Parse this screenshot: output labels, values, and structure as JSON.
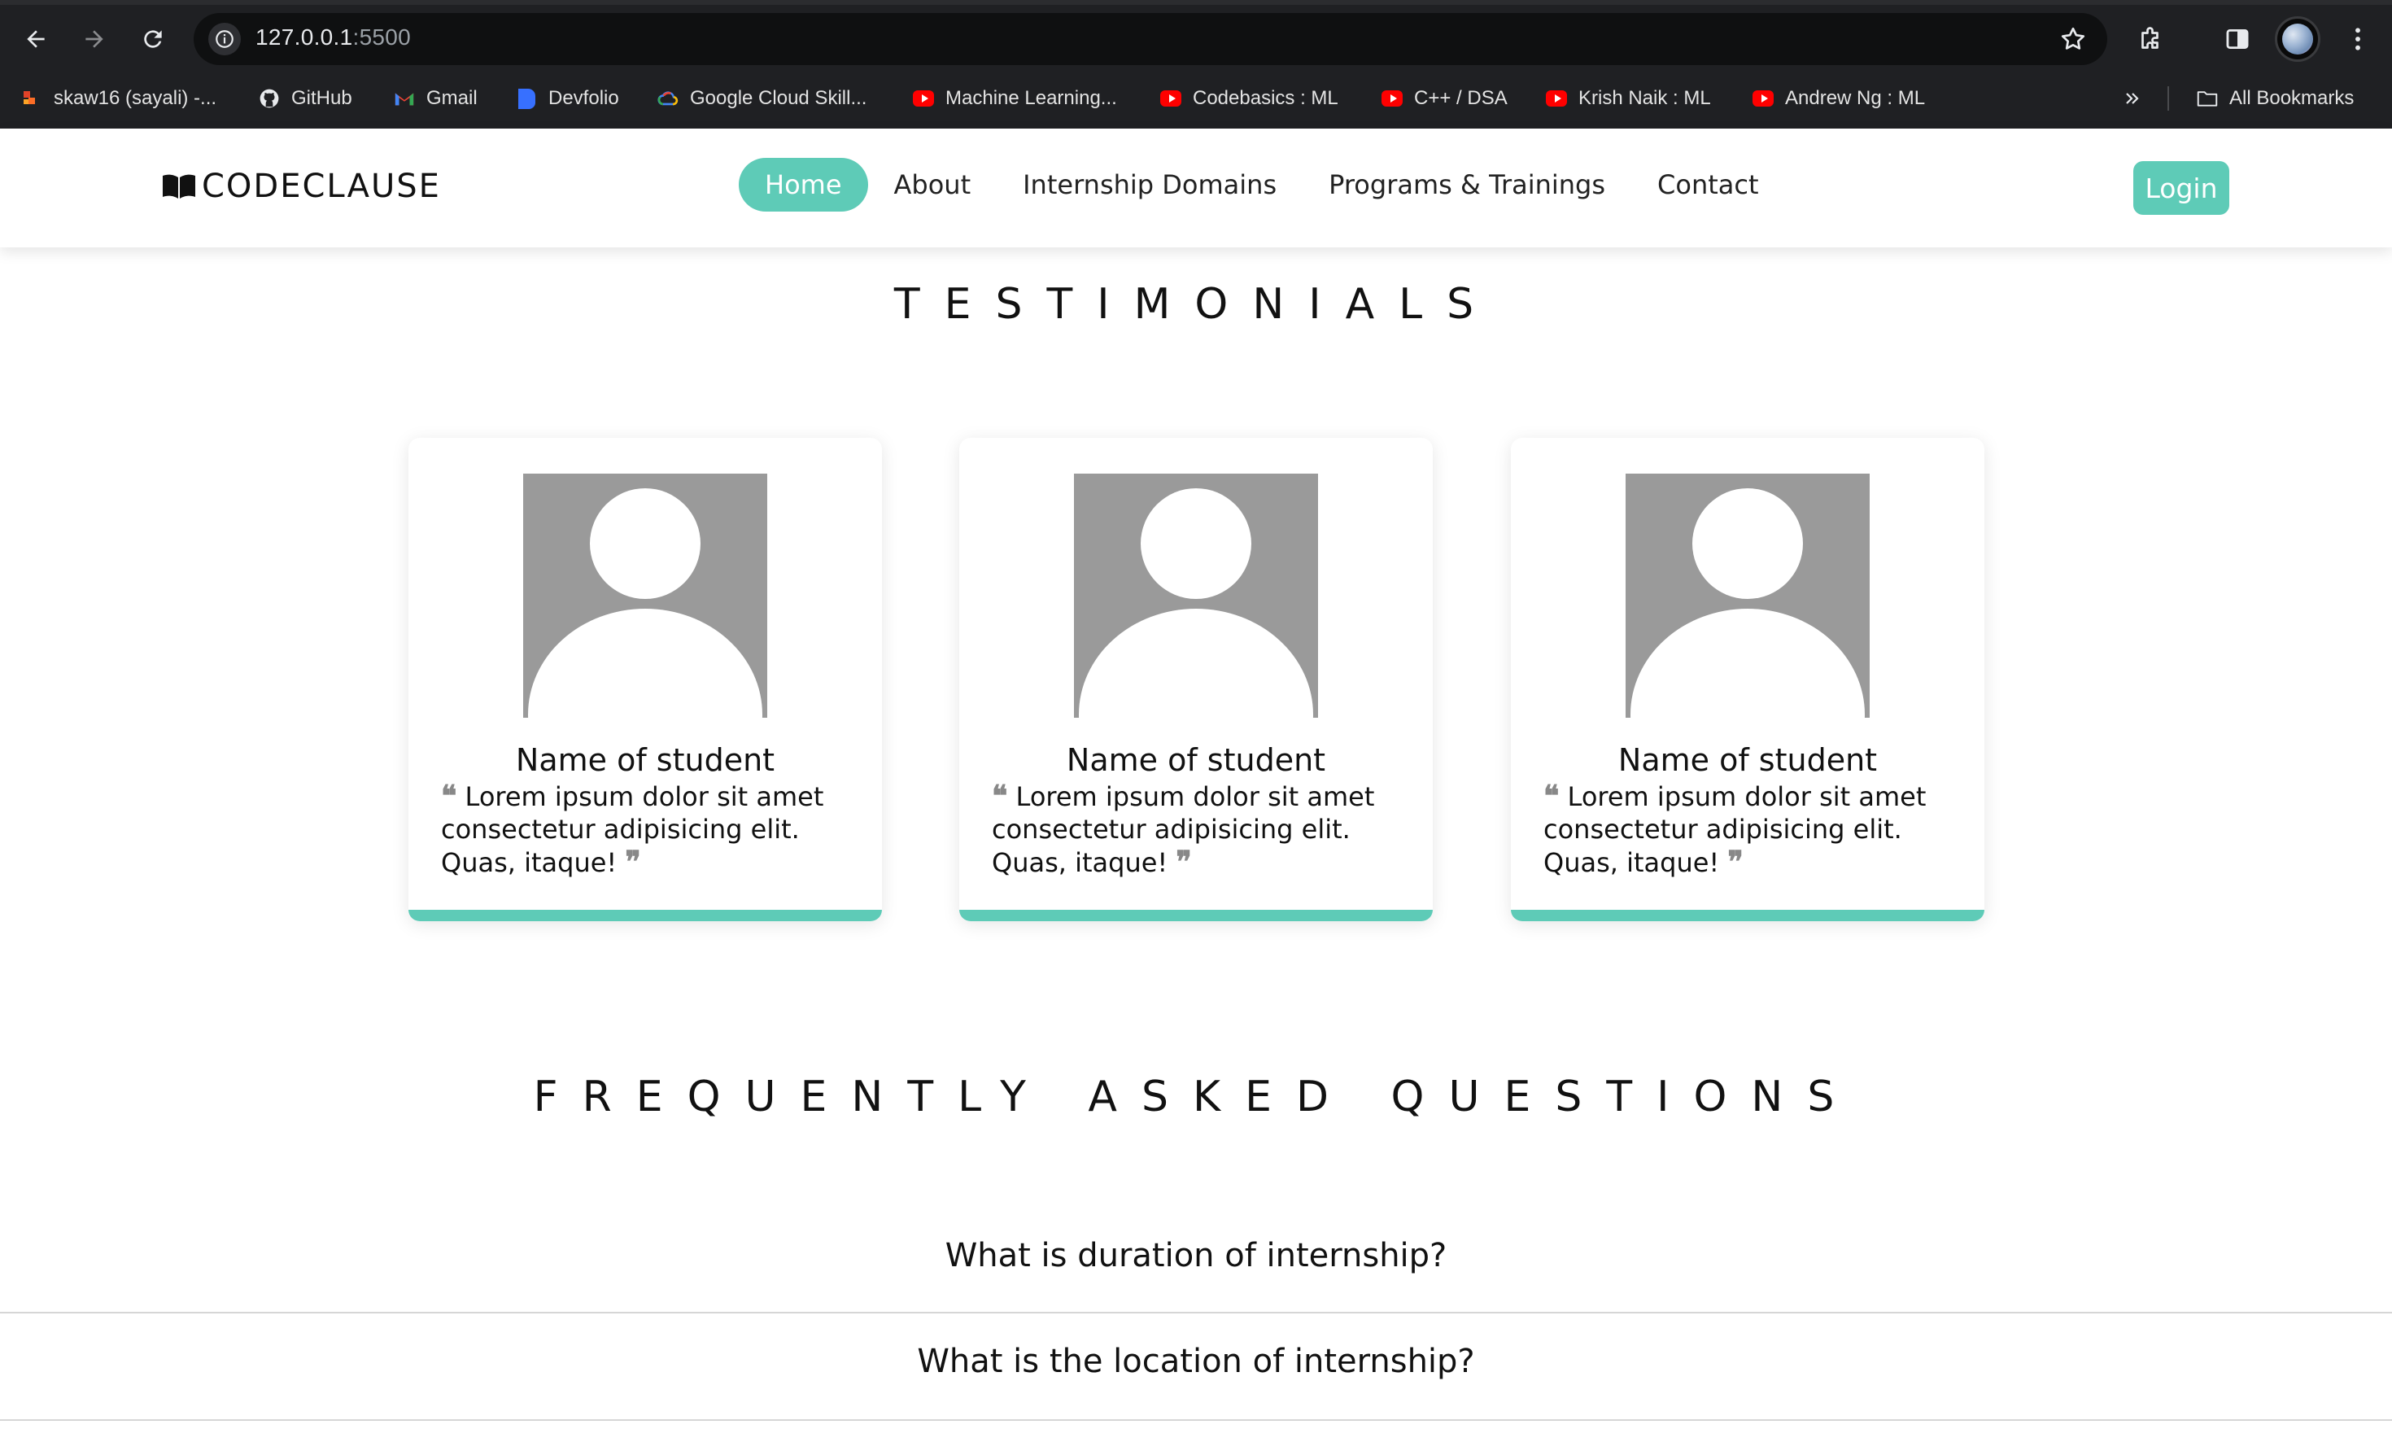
{
  "browser": {
    "url_host": "127.0.0.1",
    "url_port": ":5500",
    "bookmarks": [
      {
        "label": "skaw16 (sayali) -...",
        "icon": "gitlab-icon"
      },
      {
        "label": "GitHub",
        "icon": "github-icon"
      },
      {
        "label": "Gmail",
        "icon": "gmail-icon"
      },
      {
        "label": "Devfolio",
        "icon": "devfolio-icon"
      },
      {
        "label": "Google Cloud Skill...",
        "icon": "google-cloud-icon"
      },
      {
        "label": "Machine Learning...",
        "icon": "youtube-icon"
      },
      {
        "label": "Codebasics : ML",
        "icon": "youtube-icon"
      },
      {
        "label": "C++ / DSA",
        "icon": "youtube-icon"
      },
      {
        "label": "Krish Naik : ML",
        "icon": "youtube-icon"
      },
      {
        "label": "Andrew Ng : ML",
        "icon": "youtube-icon"
      }
    ],
    "all_bookmarks": "All Bookmarks"
  },
  "site": {
    "logo": "CODECLAUSE",
    "nav": [
      "Home",
      "About",
      "Internship Domains",
      "Programs & Trainings",
      "Contact"
    ],
    "login": "Login",
    "accent": "#5ecbb7"
  },
  "testimonials": {
    "title": "TESTIMONIALS",
    "cards": [
      {
        "name": "Name of student",
        "quote": "Lorem ipsum dolor sit amet consectetur adipisicing elit. Quas, itaque!"
      },
      {
        "name": "Name of student",
        "quote": "Lorem ipsum dolor sit amet consectetur adipisicing elit. Quas, itaque!"
      },
      {
        "name": "Name of student",
        "quote": "Lorem ipsum dolor sit amet consectetur adipisicing elit. Quas, itaque!"
      }
    ]
  },
  "faq": {
    "title": "FREQUENTLY ASKED QUESTIONS",
    "questions": [
      "What is duration of internship?",
      "What is the location of internship?"
    ]
  }
}
